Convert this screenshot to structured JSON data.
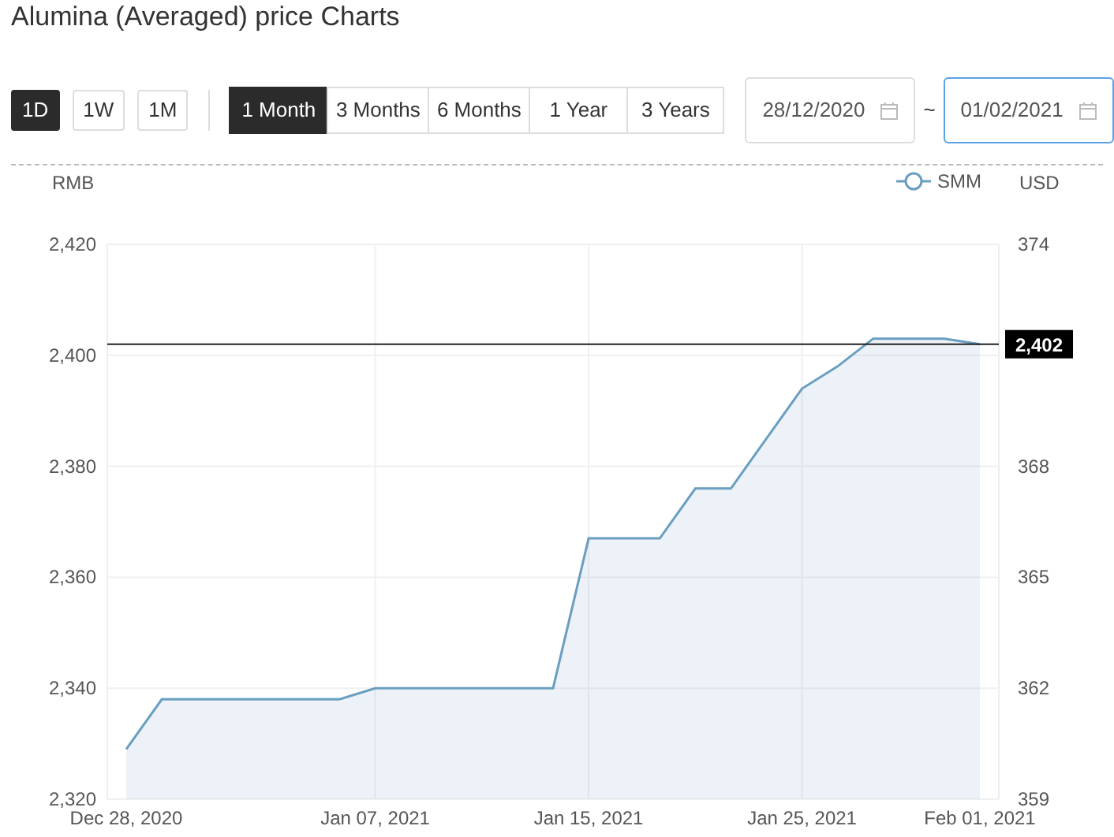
{
  "title": "Alumina (Averaged) price Charts",
  "interval_buttons": [
    {
      "label": "1D",
      "selected": true
    },
    {
      "label": "1W",
      "selected": false
    },
    {
      "label": "1M",
      "selected": false
    }
  ],
  "range_tabs": [
    {
      "label": "1 Month",
      "selected": true
    },
    {
      "label": "3 Months",
      "selected": false
    },
    {
      "label": "6 Months",
      "selected": false
    },
    {
      "label": "1 Year",
      "selected": false
    },
    {
      "label": "3 Years",
      "selected": false
    }
  ],
  "date_range": {
    "start": {
      "value": "28/12/2020",
      "focused": false
    },
    "separator": "~",
    "end": {
      "value": "01/02/2021",
      "focused": true
    }
  },
  "chart": {
    "chart_data": {
      "type": "area",
      "ylabel": "RMB",
      "categories": [
        "Dec 28, 2020",
        null,
        null,
        null,
        null,
        null,
        null,
        "Jan 07, 2021",
        null,
        null,
        null,
        null,
        null,
        "Jan 15, 2021",
        null,
        null,
        null,
        null,
        null,
        "Jan 25, 2021",
        null,
        null,
        null,
        null,
        "Feb 01, 2021"
      ],
      "grid": true,
      "series": [
        {
          "name": "SMM",
          "color": "#6a9ec0",
          "values": [
            2329,
            2338,
            2338,
            2338,
            2338,
            2338,
            2338,
            2340,
            2340,
            2340,
            2340,
            2340,
            2340,
            2367,
            2367,
            2367,
            2376,
            2376,
            2385,
            2394,
            2398,
            2403,
            2403,
            2403,
            2402
          ]
        }
      ],
      "ylim": [
        2320,
        2420
      ],
      "yticks": [
        {
          "value": 2320,
          "label": "2,320"
        },
        {
          "value": 2340,
          "label": "2,340"
        },
        {
          "value": 2360,
          "label": "2,360"
        },
        {
          "value": 2380,
          "label": "2,380"
        },
        {
          "value": 2400,
          "label": "2,400"
        },
        {
          "value": 2420,
          "label": "2,420"
        }
      ],
      "ref_lines": [
        {
          "axis": "y",
          "value": 2402,
          "label": "2,402"
        }
      ]
    },
    "right_axis": {
      "label": "USD",
      "ticks": [
        "374",
        "368",
        "365",
        "362",
        "359"
      ]
    }
  }
}
